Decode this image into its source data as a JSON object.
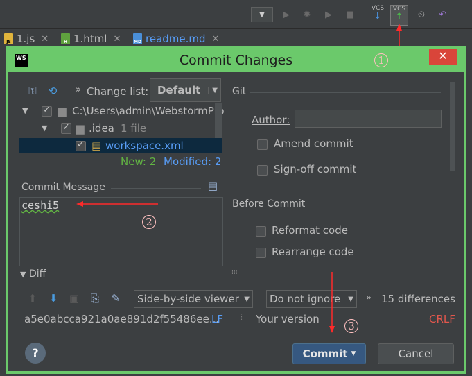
{
  "toolbar": {
    "dropdown_arrow": "▼",
    "vcs_update_label": "VCS",
    "vcs_commit_label": "VCS"
  },
  "editor_tabs": [
    {
      "icon": "JS",
      "label": "1.js"
    },
    {
      "icon": "H",
      "label": "1.html"
    },
    {
      "icon": "MD",
      "label": "readme.md"
    }
  ],
  "dialog": {
    "logo": "WS",
    "title": "Commit Changes",
    "close": "✕",
    "change_list_label": "Change list:",
    "change_list_value": "Default",
    "tree": {
      "root_path": "C:\\Users\\admin\\WebstormPro",
      "folder": ".idea",
      "folder_count": "1 file",
      "file": "workspace.xml"
    },
    "stats": {
      "new": "New: 2",
      "modified": "Modified: 2"
    },
    "commit_message_label": "Commit Message",
    "commit_message_value": "ceshi5",
    "git_label": "Git",
    "author_label": "Author:",
    "author_value": "",
    "amend_label": "Amend commit",
    "signoff_label": "Sign-off commit",
    "before_commit_label": "Before Commit",
    "reformat_label": "Reformat code",
    "rearrange_label": "Rearrange code",
    "diff_label": "Diff",
    "viewer_value": "Side-by-side viewer",
    "ignore_value": "Do not ignore",
    "differences": "15 differences",
    "hash": "a5e0abcca921a0ae891d2f55486ee...",
    "line_sep_left": "LF",
    "your_version": "Your version",
    "line_sep_right": "CRLF",
    "help": "?",
    "commit_button": "Commit",
    "cancel_button": "Cancel"
  },
  "annotations": {
    "one": "1",
    "two": "2",
    "three": "3"
  },
  "colors": {
    "accent_green": "#6bc96b",
    "close_red": "#d9453a",
    "annot_red": "#ff3030",
    "link_blue": "#589df6",
    "new_green": "#62b543"
  }
}
